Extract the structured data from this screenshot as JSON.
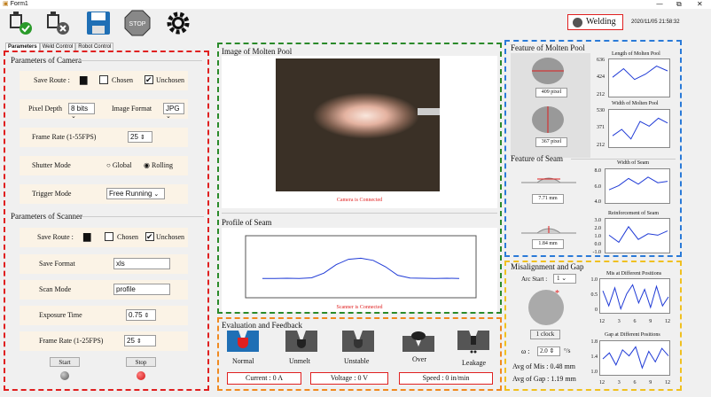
{
  "window": {
    "title": "Form1",
    "min": "—",
    "max": "⧉",
    "close": "✕"
  },
  "status": {
    "badge": "Welding",
    "time": "2020/11/05 21:58:32"
  },
  "tabs": [
    "Parameters",
    "Weld Control",
    "Robot Control"
  ],
  "camera": {
    "section": "Parameters of Camera",
    "save_route": "Save Route :",
    "chosen": "Chosen",
    "unchosen": "Unchosen",
    "pixel_depth": "Pixel Depth",
    "pixel_depth_val": "8 bits",
    "image_format": "Image Format",
    "image_format_val": "JPG",
    "frame_rate": "Frame Rate (1-55FPS)",
    "frame_rate_val": "25",
    "shutter_mode": "Shutter Mode",
    "global": "Global",
    "rolling": "Rolling",
    "trigger_mode": "Trigger Mode",
    "trigger_val": "Free Running"
  },
  "scanner": {
    "section": "Parameters of Scanner",
    "save_route": "Save Route :",
    "chosen": "Chosen",
    "unchosen": "Unchosen",
    "save_format": "Save Format",
    "save_format_val": "xls",
    "scan_mode": "Scan Mode",
    "scan_mode_val": "profile",
    "exposure": "Exposure Time",
    "exposure_val": "0.75",
    "frame_rate": "Frame Rate (1-25FPS)",
    "frame_rate_val": "25",
    "start": "Start",
    "stop": "Stop"
  },
  "image": {
    "title": "Image of Molten Pool",
    "status": "Camera is Connected"
  },
  "profile": {
    "title": "Profile of Seam",
    "status": "Scanner is Connected"
  },
  "eval": {
    "title": "Evaluation and Feedback",
    "items": [
      "Normal",
      "Unmelt",
      "Unstable",
      "Over",
      "Leakage"
    ],
    "current": "Current :    0 A",
    "voltage": "Voltage :    0 V",
    "speed": "Speed :    0 in/min"
  },
  "pool": {
    "title": "Feature of Molten Pool",
    "len_title": "Length of Molten Pool",
    "len_ticks": [
      "636",
      "424",
      "212"
    ],
    "len_val": "409 pixel",
    "wid_title": "Width of Molten Pool",
    "wid_ticks": [
      "530",
      "371",
      "212"
    ],
    "wid_val": "367 pixel"
  },
  "seam": {
    "title": "Feature of Seam",
    "w_title": "Width of Seam",
    "w_ticks": [
      "8.0",
      "6.0",
      "4.0"
    ],
    "w_val": "7.71 mm",
    "r_title": "Reinforcement of Seam",
    "r_ticks": [
      "3.0",
      "2.0",
      "1.0",
      "0.0",
      "-1.0"
    ],
    "r_val": "1.84 mm"
  },
  "mis": {
    "title": "Misalignment and Gap",
    "arc_label": "Arc Start :",
    "arc_val": "1",
    "clock": "1 clock",
    "omega": "ω :",
    "omega_val": "2.0",
    "omega_unit": "°/s",
    "avg_mis": "Avg of Mis : 0.48 mm",
    "avg_gap": "Avg of Gap : 1.19 mm",
    "m_title": "Mis at Different Positions",
    "m_ticks": [
      "1.0",
      "0.5",
      "0"
    ],
    "g_title": "Gap at Different Positions",
    "g_ticks": [
      "1.8",
      "1.4",
      "1.0"
    ],
    "x_ticks": [
      "12",
      "3",
      "6",
      "9",
      "12"
    ]
  },
  "series": {
    "len": [
      0.55,
      0.82,
      0.48,
      0.65,
      0.9,
      0.75
    ],
    "wid": [
      0.3,
      0.5,
      0.2,
      0.75,
      0.6,
      0.85,
      0.7
    ],
    "sw": [
      0.4,
      0.55,
      0.8,
      0.6,
      0.85,
      0.65,
      0.7
    ],
    "sr": [
      0.55,
      0.3,
      0.85,
      0.4,
      0.6,
      0.55,
      0.7
    ],
    "mis": [
      0.7,
      0.2,
      0.8,
      0.1,
      0.6,
      0.9,
      0.3,
      0.75,
      0.15,
      0.85,
      0.2,
      0.5
    ],
    "gap": [
      0.5,
      0.7,
      0.3,
      0.8,
      0.6,
      0.9,
      0.2,
      0.75,
      0.4,
      0.85,
      0.6
    ],
    "profile": [
      0.05,
      0.05,
      0.06,
      0.05,
      0.08,
      0.3,
      0.7,
      0.95,
      1.0,
      0.9,
      0.6,
      0.2,
      0.07,
      0.06,
      0.05,
      0.06,
      0.05
    ]
  }
}
